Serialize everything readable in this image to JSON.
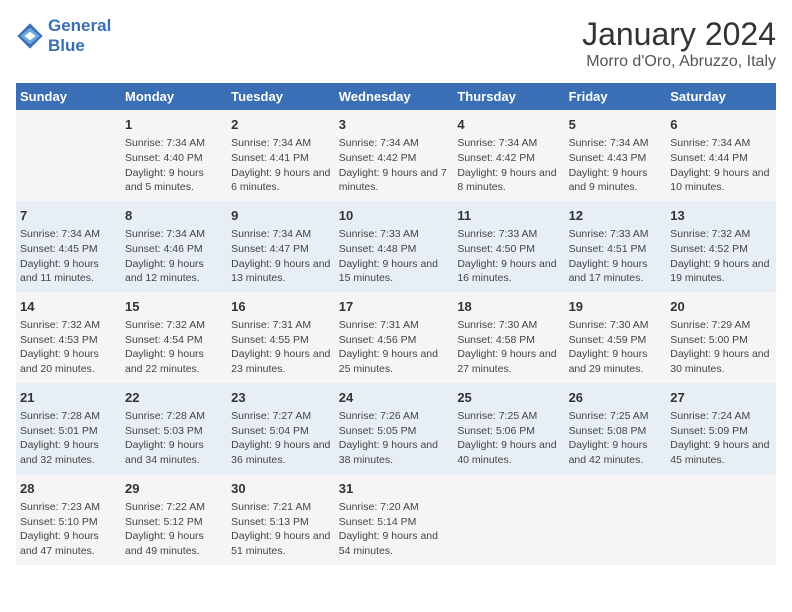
{
  "logo": {
    "line1": "General",
    "line2": "Blue"
  },
  "title": "January 2024",
  "subtitle": "Morro d'Oro, Abruzzo, Italy",
  "headers": [
    "Sunday",
    "Monday",
    "Tuesday",
    "Wednesday",
    "Thursday",
    "Friday",
    "Saturday"
  ],
  "weeks": [
    [
      {
        "day": "",
        "sunrise": "",
        "sunset": "",
        "daylight": ""
      },
      {
        "day": "1",
        "sunrise": "Sunrise: 7:34 AM",
        "sunset": "Sunset: 4:40 PM",
        "daylight": "Daylight: 9 hours and 5 minutes."
      },
      {
        "day": "2",
        "sunrise": "Sunrise: 7:34 AM",
        "sunset": "Sunset: 4:41 PM",
        "daylight": "Daylight: 9 hours and 6 minutes."
      },
      {
        "day": "3",
        "sunrise": "Sunrise: 7:34 AM",
        "sunset": "Sunset: 4:42 PM",
        "daylight": "Daylight: 9 hours and 7 minutes."
      },
      {
        "day": "4",
        "sunrise": "Sunrise: 7:34 AM",
        "sunset": "Sunset: 4:42 PM",
        "daylight": "Daylight: 9 hours and 8 minutes."
      },
      {
        "day": "5",
        "sunrise": "Sunrise: 7:34 AM",
        "sunset": "Sunset: 4:43 PM",
        "daylight": "Daylight: 9 hours and 9 minutes."
      },
      {
        "day": "6",
        "sunrise": "Sunrise: 7:34 AM",
        "sunset": "Sunset: 4:44 PM",
        "daylight": "Daylight: 9 hours and 10 minutes."
      }
    ],
    [
      {
        "day": "7",
        "sunrise": "Sunrise: 7:34 AM",
        "sunset": "Sunset: 4:45 PM",
        "daylight": "Daylight: 9 hours and 11 minutes."
      },
      {
        "day": "8",
        "sunrise": "Sunrise: 7:34 AM",
        "sunset": "Sunset: 4:46 PM",
        "daylight": "Daylight: 9 hours and 12 minutes."
      },
      {
        "day": "9",
        "sunrise": "Sunrise: 7:34 AM",
        "sunset": "Sunset: 4:47 PM",
        "daylight": "Daylight: 9 hours and 13 minutes."
      },
      {
        "day": "10",
        "sunrise": "Sunrise: 7:33 AM",
        "sunset": "Sunset: 4:48 PM",
        "daylight": "Daylight: 9 hours and 15 minutes."
      },
      {
        "day": "11",
        "sunrise": "Sunrise: 7:33 AM",
        "sunset": "Sunset: 4:50 PM",
        "daylight": "Daylight: 9 hours and 16 minutes."
      },
      {
        "day": "12",
        "sunrise": "Sunrise: 7:33 AM",
        "sunset": "Sunset: 4:51 PM",
        "daylight": "Daylight: 9 hours and 17 minutes."
      },
      {
        "day": "13",
        "sunrise": "Sunrise: 7:32 AM",
        "sunset": "Sunset: 4:52 PM",
        "daylight": "Daylight: 9 hours and 19 minutes."
      }
    ],
    [
      {
        "day": "14",
        "sunrise": "Sunrise: 7:32 AM",
        "sunset": "Sunset: 4:53 PM",
        "daylight": "Daylight: 9 hours and 20 minutes."
      },
      {
        "day": "15",
        "sunrise": "Sunrise: 7:32 AM",
        "sunset": "Sunset: 4:54 PM",
        "daylight": "Daylight: 9 hours and 22 minutes."
      },
      {
        "day": "16",
        "sunrise": "Sunrise: 7:31 AM",
        "sunset": "Sunset: 4:55 PM",
        "daylight": "Daylight: 9 hours and 23 minutes."
      },
      {
        "day": "17",
        "sunrise": "Sunrise: 7:31 AM",
        "sunset": "Sunset: 4:56 PM",
        "daylight": "Daylight: 9 hours and 25 minutes."
      },
      {
        "day": "18",
        "sunrise": "Sunrise: 7:30 AM",
        "sunset": "Sunset: 4:58 PM",
        "daylight": "Daylight: 9 hours and 27 minutes."
      },
      {
        "day": "19",
        "sunrise": "Sunrise: 7:30 AM",
        "sunset": "Sunset: 4:59 PM",
        "daylight": "Daylight: 9 hours and 29 minutes."
      },
      {
        "day": "20",
        "sunrise": "Sunrise: 7:29 AM",
        "sunset": "Sunset: 5:00 PM",
        "daylight": "Daylight: 9 hours and 30 minutes."
      }
    ],
    [
      {
        "day": "21",
        "sunrise": "Sunrise: 7:28 AM",
        "sunset": "Sunset: 5:01 PM",
        "daylight": "Daylight: 9 hours and 32 minutes."
      },
      {
        "day": "22",
        "sunrise": "Sunrise: 7:28 AM",
        "sunset": "Sunset: 5:03 PM",
        "daylight": "Daylight: 9 hours and 34 minutes."
      },
      {
        "day": "23",
        "sunrise": "Sunrise: 7:27 AM",
        "sunset": "Sunset: 5:04 PM",
        "daylight": "Daylight: 9 hours and 36 minutes."
      },
      {
        "day": "24",
        "sunrise": "Sunrise: 7:26 AM",
        "sunset": "Sunset: 5:05 PM",
        "daylight": "Daylight: 9 hours and 38 minutes."
      },
      {
        "day": "25",
        "sunrise": "Sunrise: 7:25 AM",
        "sunset": "Sunset: 5:06 PM",
        "daylight": "Daylight: 9 hours and 40 minutes."
      },
      {
        "day": "26",
        "sunrise": "Sunrise: 7:25 AM",
        "sunset": "Sunset: 5:08 PM",
        "daylight": "Daylight: 9 hours and 42 minutes."
      },
      {
        "day": "27",
        "sunrise": "Sunrise: 7:24 AM",
        "sunset": "Sunset: 5:09 PM",
        "daylight": "Daylight: 9 hours and 45 minutes."
      }
    ],
    [
      {
        "day": "28",
        "sunrise": "Sunrise: 7:23 AM",
        "sunset": "Sunset: 5:10 PM",
        "daylight": "Daylight: 9 hours and 47 minutes."
      },
      {
        "day": "29",
        "sunrise": "Sunrise: 7:22 AM",
        "sunset": "Sunset: 5:12 PM",
        "daylight": "Daylight: 9 hours and 49 minutes."
      },
      {
        "day": "30",
        "sunrise": "Sunrise: 7:21 AM",
        "sunset": "Sunset: 5:13 PM",
        "daylight": "Daylight: 9 hours and 51 minutes."
      },
      {
        "day": "31",
        "sunrise": "Sunrise: 7:20 AM",
        "sunset": "Sunset: 5:14 PM",
        "daylight": "Daylight: 9 hours and 54 minutes."
      },
      {
        "day": "",
        "sunrise": "",
        "sunset": "",
        "daylight": ""
      },
      {
        "day": "",
        "sunrise": "",
        "sunset": "",
        "daylight": ""
      },
      {
        "day": "",
        "sunrise": "",
        "sunset": "",
        "daylight": ""
      }
    ]
  ]
}
